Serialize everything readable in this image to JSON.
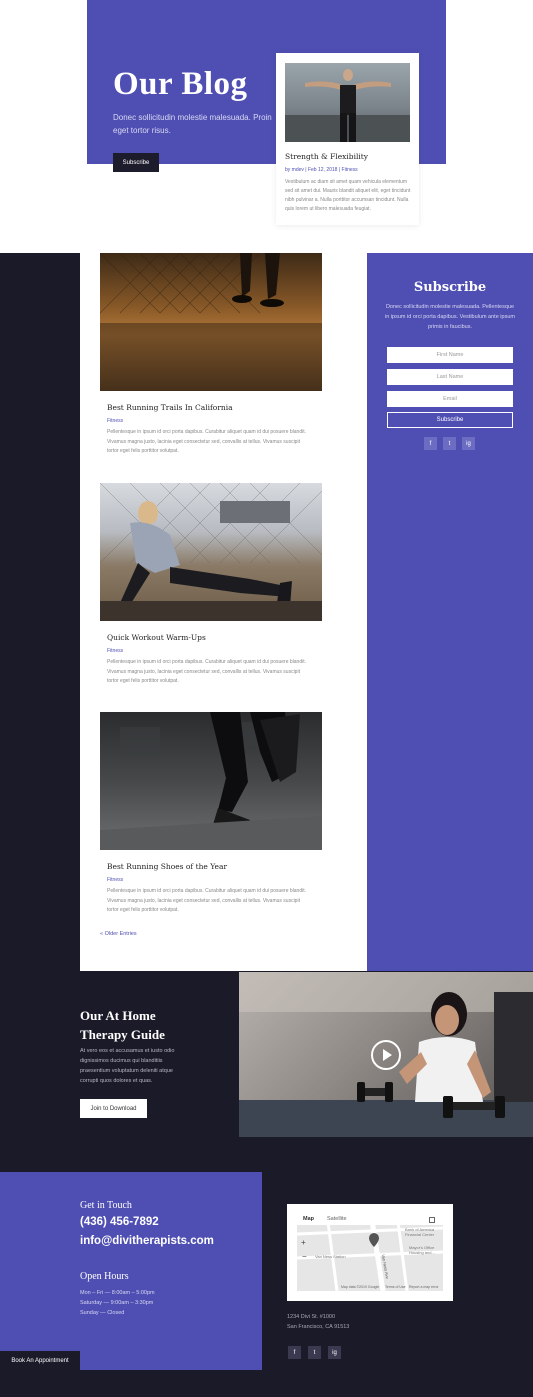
{
  "hero": {
    "title": "Our Blog",
    "subtitle": "Donec sollicitudin molestie malesuada. Proin eget tortor risus.",
    "button": "Subscribe"
  },
  "featured": {
    "title": "Strength & Flexibility",
    "meta": "by mdev | Feb 12, 2018 | Fitness",
    "excerpt": "Vestibulum ac diam sit amet quam vehicula elementum sed sit amet dui. Mauris blandit aliquet elit, eget tincidunt nibh pulvinar a. Nulla porttitor accumsan tincidunt. Nulla quis lorem ut libero malesuada feugiat."
  },
  "posts": [
    {
      "title": "Best Running Trails In California",
      "category": "Fitness",
      "excerpt": "Pellentesque in ipsum id orci porta dapibus. Curabitur aliquet quam id dui posuere blandit. Vivamus magna justo, lacinia eget consectetur sed, convallis at tellus. Vivamus suscipit tortor eget felis porttitor volutpat."
    },
    {
      "title": "Quick Workout Warm-Ups",
      "category": "Fitness",
      "excerpt": "Pellentesque in ipsum id orci porta dapibus. Curabitur aliquet quam id dui posuere blandit. Vivamus magna justo, lacinia eget consectetur sed, convallis at tellus. Vivamus suscipit tortor eget felis porttitor volutpat."
    },
    {
      "title": "Best Running Shoes of the Year",
      "category": "Fitness",
      "excerpt": "Pellentesque in ipsum id orci porta dapibus. Curabitur aliquet quam id dui posuere blandit. Vivamus magna justo, lacinia eget consectetur sed, convallis at tellus. Vivamus suscipit tortor eget felis porttitor volutpat."
    }
  ],
  "older_entries": "« Older Entries",
  "subscribe": {
    "title": "Subscribe",
    "text": "Donec sollicitudin molestie malesuada. Pellentesque in ipsum id orci porta dapibus. Vestibulum ante ipsum primis in faucibus.",
    "first_name": "First Name",
    "last_name": "Last Name",
    "email": "Email",
    "button": "Subscribe",
    "social": [
      "f",
      "t",
      "ig"
    ]
  },
  "guide": {
    "title": "Our At Home Therapy Guide",
    "text": "At vero eos et accusamus et iusto odio dignissimos ducimus qui blanditiis praesentium voluptatum deleniti atque corrupti quos dolores et quas.",
    "button": "Join to Download"
  },
  "contact": {
    "heading": "Get in Touch",
    "phone": "(436) 456-7892",
    "email": "info@divitherapists.com",
    "hours_heading": "Open Hours",
    "hours": [
      "Mon – Fri — 8:00am – 5:00pm",
      "Saturday — 9:00am – 3:30pm",
      "Sunday — Closed"
    ],
    "book_button": "Book An Appointment"
  },
  "map": {
    "tab_map": "Map",
    "tab_satellite": "Satellite",
    "label_bank": "Bank of America Financial Center",
    "label_mayor": "Mayor's Office Housing and...",
    "label_station": "Van Ness Station",
    "label_street": "Van Ness Ave",
    "credit": "Map data ©2019 Google",
    "terms": "Terms of Use",
    "report": "Report a map error"
  },
  "address": {
    "line1": "1234 Divi St. #1000",
    "line2": "San Francisco, CA 91513"
  },
  "colors": {
    "brand": "#4f4fb3",
    "dark": "#1b1a29"
  }
}
